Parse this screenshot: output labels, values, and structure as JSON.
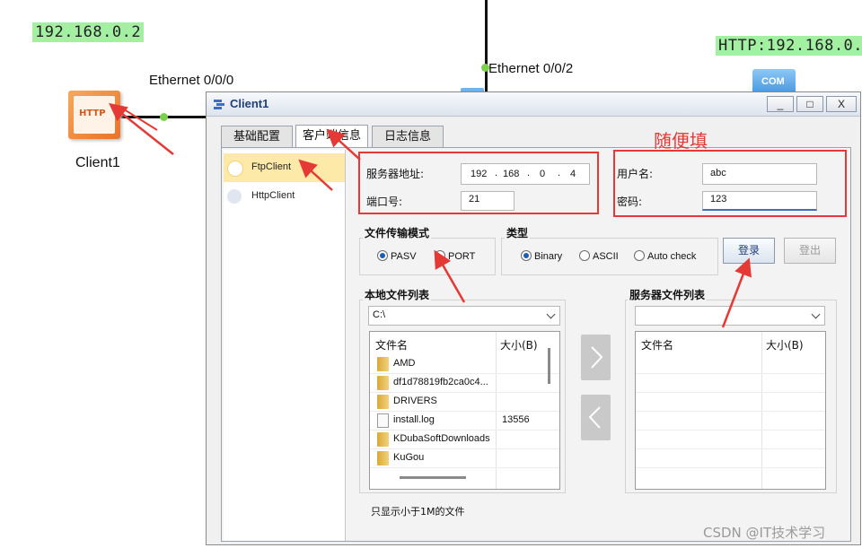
{
  "topology": {
    "left_ip": "192.168.0.2",
    "right_ip": "HTTP:192.168.0.",
    "left_port": "Ethernet 0/0/0",
    "top_port": "Ethernet 0/0/2",
    "client_label": "Client1",
    "left_device_icon_text": "HTTP",
    "right_device_icon_text": "COM"
  },
  "window": {
    "title": "Client1",
    "min": "_",
    "max": "□",
    "close": "X"
  },
  "tabs": [
    "基础配置",
    "客户端信息",
    "日志信息"
  ],
  "sidebar": {
    "items": [
      {
        "label": "FtpClient",
        "selected": true
      },
      {
        "label": "HttpClient",
        "selected": false
      }
    ]
  },
  "server": {
    "addr_label": "服务器地址:",
    "ip": [
      "192",
      "168",
      "0",
      "4"
    ],
    "port_label": "端口号:",
    "port": "21"
  },
  "auth": {
    "user_label": "用户名:",
    "user": "abc",
    "pass_label": "密码:",
    "pass": "123"
  },
  "annotation": "随便填",
  "transfer_mode": {
    "title": "文件传输模式",
    "options": [
      "PASV",
      "PORT"
    ],
    "selected": "PASV"
  },
  "type": {
    "title": "类型",
    "options": [
      "Binary",
      "ASCII",
      "Auto check"
    ],
    "selected": "Binary"
  },
  "buttons": {
    "login": "登录",
    "logout": "登出"
  },
  "local": {
    "title": "本地文件列表",
    "path": "C:\\",
    "col_name": "文件名",
    "col_size": "大小(B)",
    "files": [
      {
        "name": "AMD",
        "size": "",
        "type": "folder"
      },
      {
        "name": "df1d78819fb2ca0c4...",
        "size": "",
        "type": "folder"
      },
      {
        "name": "DRIVERS",
        "size": "",
        "type": "folder"
      },
      {
        "name": "install.log",
        "size": "13556",
        "type": "file"
      },
      {
        "name": "KDubaSoftDownloads",
        "size": "",
        "type": "folder"
      },
      {
        "name": "KuGou",
        "size": "",
        "type": "folder"
      }
    ]
  },
  "remote": {
    "title": "服务器文件列表",
    "path": "",
    "col_name": "文件名",
    "col_size": "大小(B)"
  },
  "footer_note": "只显示小于1M的文件",
  "watermark": "CSDN @IT技术学习",
  "colors": {
    "accent_red": "#e53935",
    "selected_item": "#fde9a8",
    "ip_badge": "#a3f0a3"
  }
}
